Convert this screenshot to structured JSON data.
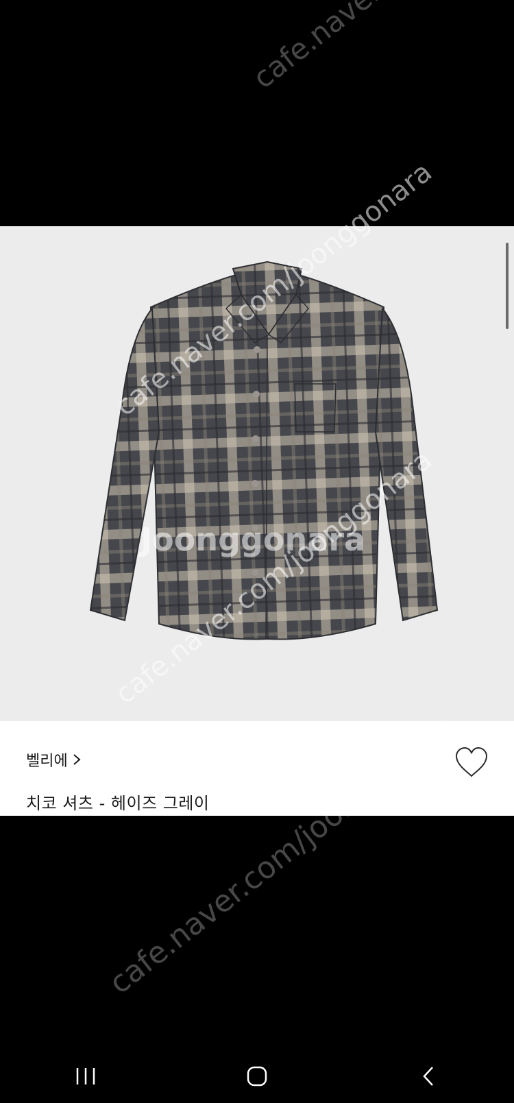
{
  "listing": {
    "brand": "벨리에",
    "product_title": "치코 셔츠 - 헤이즈 그레이"
  },
  "watermark": {
    "url": "cafe.naver.com/joonggonara",
    "logo": "Joonggonara"
  },
  "icons": {
    "brand_chevron": "chevron-right-icon",
    "favorite": "heart-outline-icon",
    "nav_recents": "recents-icon",
    "nav_home": "home-icon",
    "nav_back": "back-icon"
  },
  "colors": {
    "photo_background": "#ececec",
    "info_background": "#ffffff",
    "text": "#1a1a1a",
    "shirt_dark": "#3e3f44",
    "shirt_light": "#cfc6b4"
  }
}
